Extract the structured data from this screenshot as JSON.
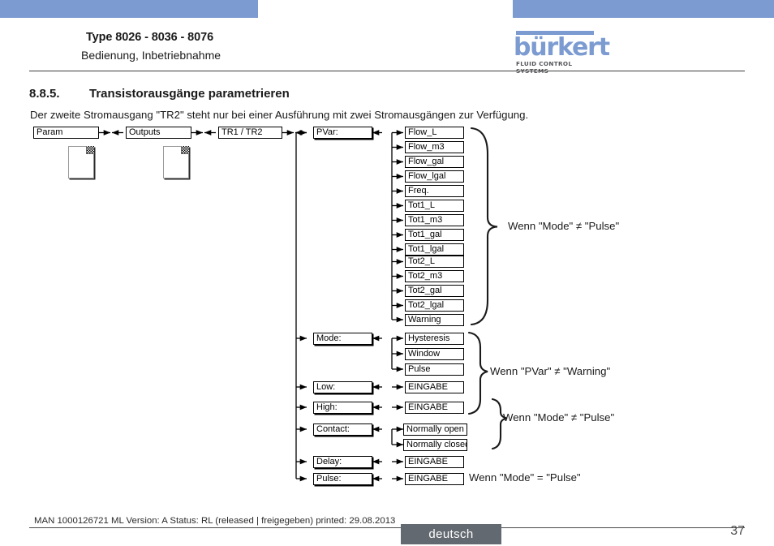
{
  "header": {
    "title": "Type 8026 - 8036 - 8076",
    "subtitle": "Bedienung, Inbetriebnahme",
    "logo_word": "bürkert",
    "logo_tagline": "FLUID CONTROL SYSTEMS",
    "accent_color": "#7b9bd1"
  },
  "section": {
    "number": "8.8.5.",
    "title": "Transistorausgänge parametrieren",
    "intro": "Der zweite Stromausgang \"TR2\" steht nur bei einer Ausführung mit zwei Stromausgängen zur Verfügung."
  },
  "diagram": {
    "breadcrumb": [
      {
        "label": "Param"
      },
      {
        "label": "Outputs"
      },
      {
        "label": "TR1 / TR2"
      }
    ],
    "parameters": [
      {
        "label": "PVar:"
      },
      {
        "label": "Mode:"
      },
      {
        "label": "Low:"
      },
      {
        "label": "High:"
      },
      {
        "label": "Contact:"
      },
      {
        "label": "Delay:"
      },
      {
        "label": "Pulse:"
      }
    ],
    "pvar_values": [
      "Flow_L",
      "Flow_m3",
      "Flow_gal",
      "Flow_lgal",
      "Freq.",
      "Tot1_L",
      "Tot1_m3",
      "Tot1_gal",
      "Tot1_lgal",
      "Tot2_L",
      "Tot2_m3",
      "Tot2_gal",
      "Tot2_lgal",
      "Warning"
    ],
    "mode_values": [
      "Hysteresis",
      "Window",
      "Pulse"
    ],
    "low_value": "EINGABE",
    "high_value": "EINGABE",
    "contact_values": [
      "Normally open",
      "Normally closed"
    ],
    "delay_value": "EINGABE",
    "pulse_value": "EINGABE",
    "annotations": [
      {
        "text": "Wenn \"Mode\" ≠ \"Pulse\""
      },
      {
        "text": "Wenn \"PVar\" ≠ \"Warning\""
      },
      {
        "text": "Wenn \"Mode\" ≠ \"Pulse\""
      },
      {
        "text": "Wenn \"Mode\" = \"Pulse\""
      }
    ]
  },
  "footer": {
    "document_info": "MAN 1000126721 ML  Version: A Status: RL (released | freigegeben)  printed: 29.08.2013",
    "language": "deutsch",
    "page_number": "37"
  }
}
